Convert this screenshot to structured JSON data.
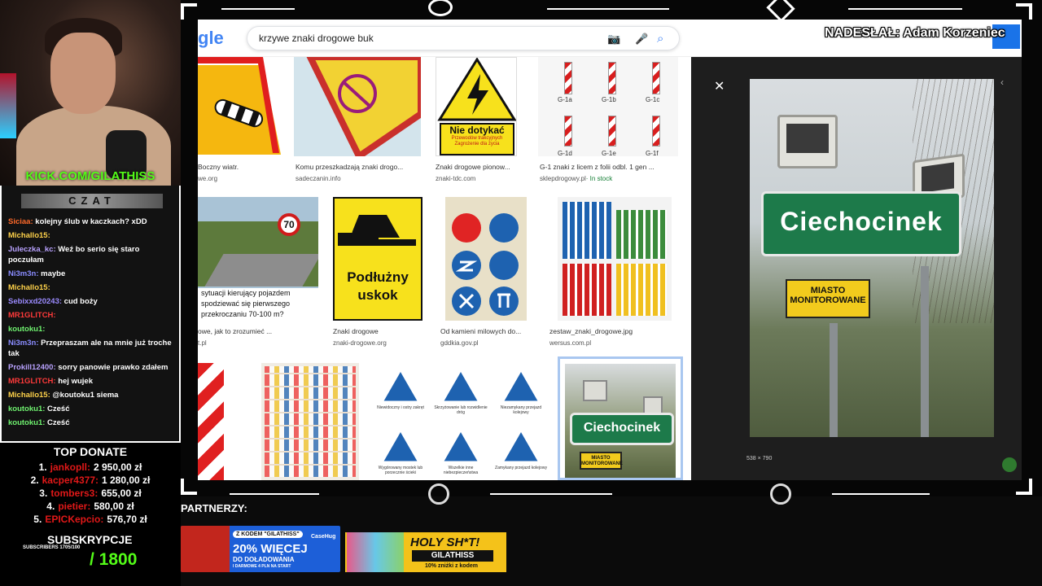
{
  "stream": {
    "kick_url": "KICK.COM/GILATHISS",
    "chat_header": "CZAT",
    "chat_messages": [
      {
        "user": "Siciaa:",
        "text": "kolejny ślub w kaczkach? xDD",
        "color": "#ff6a2a"
      },
      {
        "user": "Michallo15:",
        "text": "",
        "color": "#ffd24a"
      },
      {
        "user": "Juleczka_kc:",
        "text": "Weź bo serio się staro poczułam",
        "color": "#b9a2ff"
      },
      {
        "user": "Ni3m3n:",
        "text": "maybe",
        "color": "#8a8cff"
      },
      {
        "user": "Michallo15:",
        "text": "",
        "color": "#ffd24a"
      },
      {
        "user": "Sebixxd20243:",
        "text": "cud boży",
        "color": "#9b8bff"
      },
      {
        "user": "MR1GLITCH:",
        "text": "",
        "color": "#ff3a3a"
      },
      {
        "user": "koutoku1:",
        "text": "",
        "color": "#6ff26f"
      },
      {
        "user": "Ni3m3n:",
        "text": "Przepraszam ale na mnie już troche tak",
        "color": "#8a8cff"
      },
      {
        "user": "Prokill12400:",
        "text": "sorry panowie prawko zdałem",
        "color": "#b9a2ff"
      },
      {
        "user": "MR1GLITCH:",
        "text": "hej wujek",
        "color": "#ff3a3a"
      },
      {
        "user": "Michallo15:",
        "text": "@koutoku1 siema",
        "color": "#ffd24a"
      },
      {
        "user": "koutoku1:",
        "text": "Cześć",
        "color": "#6ff26f"
      },
      {
        "user": "koutoku1:",
        "text": "Cześć",
        "color": "#6ff26f"
      }
    ],
    "donate_title": "TOP DONATE",
    "donations": [
      {
        "rank": "1.",
        "name": "jankopll:",
        "amount": "2 950,00 zł"
      },
      {
        "rank": "2.",
        "name": "kacper4377:",
        "amount": "1 280,00 zł"
      },
      {
        "rank": "3.",
        "name": "tombers3:",
        "amount": "655,00 zł"
      },
      {
        "rank": "4.",
        "name": "pietier:",
        "amount": "580,00 zł"
      },
      {
        "rank": "5.",
        "name": "EPICKepcio:",
        "amount": "576,70 zł"
      }
    ],
    "subs_title": "SUBSKRYPCJE",
    "subs_small": "SUBSCRIBERS 1705/100",
    "subs_goal": "/ 1800",
    "partners_label": "PARTNERZY:",
    "ad1": {
      "code": "Z KODEM \"GILATHISS\"",
      "brand": "CaseHug",
      "headline": "20% WIĘCEJ",
      "sub": "DO DOŁADOWANIA",
      "note": "I DARMOWE 4 PLN NA START"
    },
    "ad2": {
      "headline": "HOLY SH*T!",
      "code": "GILATHISS",
      "note": "10% zniżki z kodem"
    }
  },
  "browser": {
    "logo": "gle",
    "search_query": "krzywe znaki drogowe buk",
    "overlay_credit": "NADESŁAŁ: Adam Korzeniec",
    "results": [
      {
        "caption": "Boczny wiatr.",
        "source": "we.org"
      },
      {
        "caption": "Komu przeszkadzają znaki drogo...",
        "source": "sadeczanin.info"
      },
      {
        "caption": "Znaki drogowe pionow...",
        "source": "znaki-tdc.com"
      },
      {
        "caption": "G-1 znaki z licem z folii odbl. 1 gen ...",
        "source": "sklepdrogowy.pl",
        "stock": "· In stock"
      },
      {
        "caption": "owe, jak to zrozumieć ...",
        "source": "t.pl"
      },
      {
        "caption": "Znaki drogowe",
        "source": "znaki-drogowe.org"
      },
      {
        "caption": "Od kamieni milowych do...",
        "source": "gddkia.gov.pl"
      },
      {
        "caption": "zestaw_znaki_drogowe.jpg",
        "source": "wersus.com.pl"
      }
    ],
    "tile_text": {
      "nie_dotykac": "Nie dotykać",
      "nie_dotykac_sub": "Przewodów trakcyjnych Zagrożenie dla życia",
      "g1_labels": [
        "G-1a",
        "G-1b",
        "G-1c",
        "G-1d",
        "G-1e",
        "G-1f"
      ],
      "speed": "70",
      "podluzny": "Podłużny",
      "uskok": "uskok",
      "road_text_1": "sytuacji kierujący pojazdem",
      "road_text_2": "spodziewać się pierwszego",
      "road_text_3": "przekroczaniu 70-100 m?",
      "warn_labels": [
        "Niewidoczny i ostry zakręt",
        "Skrzyżowanie lub rozwidlenie dróg",
        "Niezamykany przejazd kolejowy",
        "Wygórowany mostek lub porzecznie ścieki",
        "Wszelkie inne niebezpieczeństwa",
        "Zamykany przejazd kolejowy"
      ]
    },
    "preview": {
      "town": "Ciechocinek",
      "plate_line1": "MIASTO",
      "plate_line2": "MONITOROWANE",
      "dims": "538 × 790"
    }
  }
}
